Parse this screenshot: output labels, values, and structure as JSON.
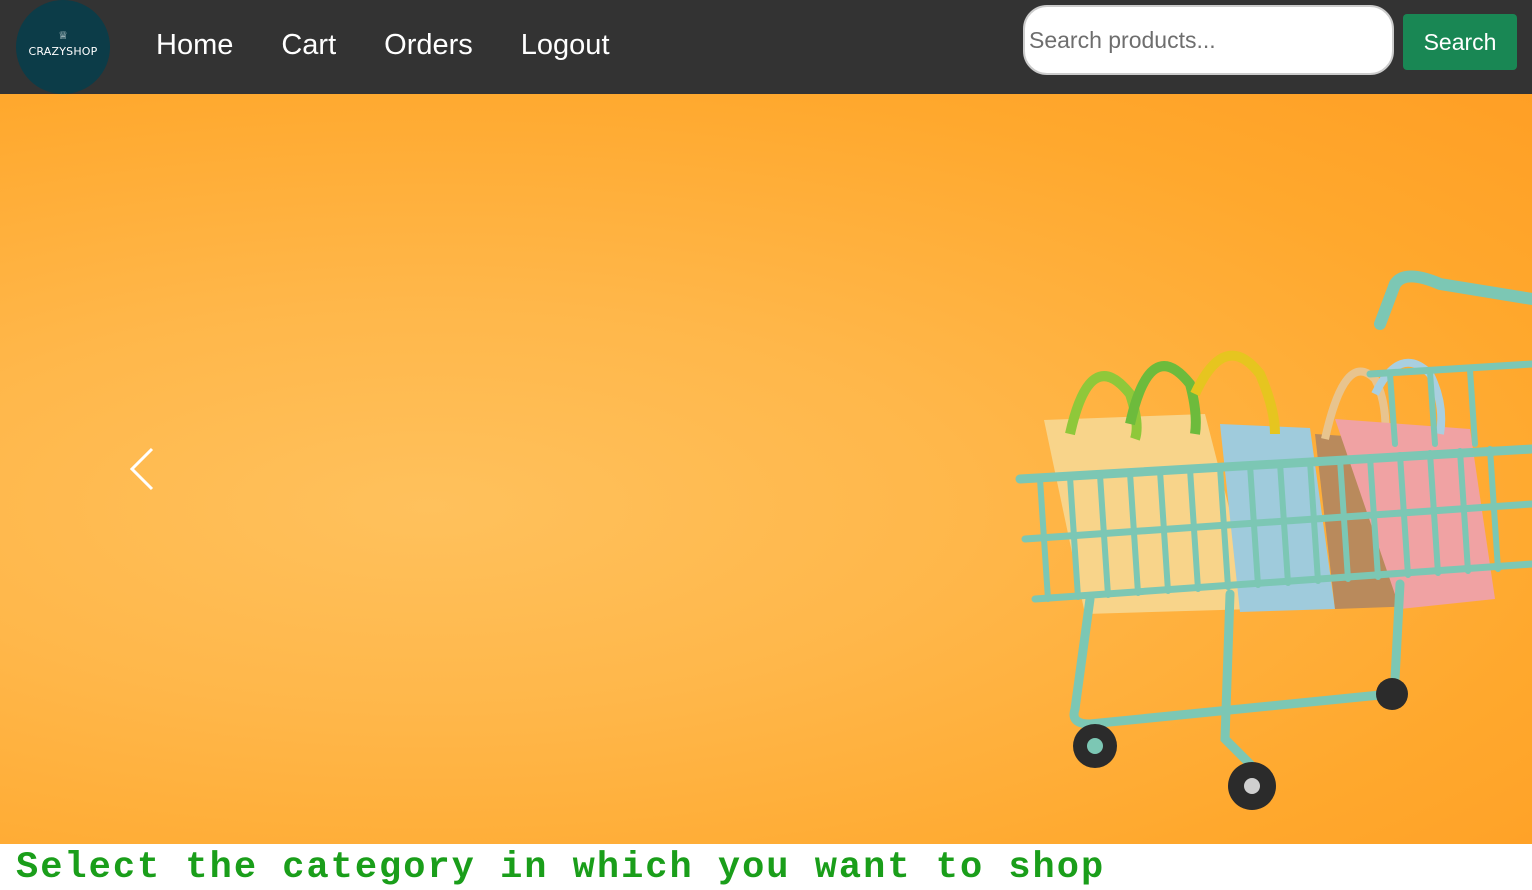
{
  "brand": {
    "name": "CRAZYSHOP",
    "logo_bg": "#0c3c48"
  },
  "nav": {
    "links": [
      "Home",
      "Cart",
      "Orders",
      "Logout"
    ]
  },
  "search": {
    "placeholder": "Search products...",
    "value": "",
    "button_label": "Search",
    "button_color": "#198754"
  },
  "hero": {
    "background": "#ffb347",
    "illustration": "shopping-cart-with-bags",
    "prev_icon": "chevron-left-icon"
  },
  "content": {
    "heading": "Select the category in which you want to shop",
    "heading_color": "#1a9e1a"
  },
  "colors": {
    "navbar_bg": "#333333",
    "nav_text": "#ffffff"
  }
}
